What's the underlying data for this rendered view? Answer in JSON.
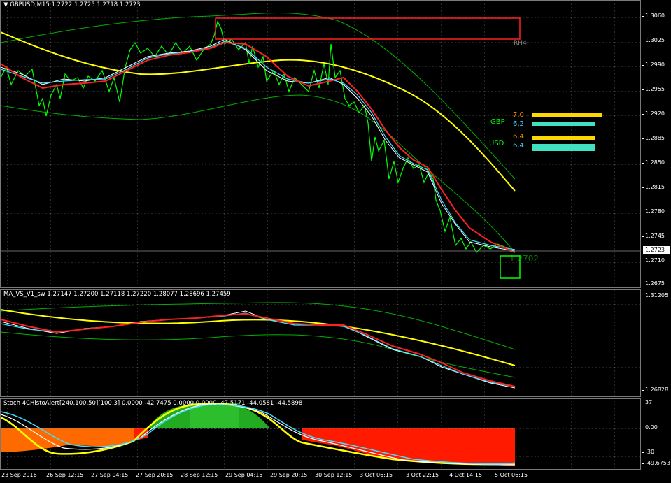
{
  "main_chart": {
    "title": "GBPUSD,M15  1.2722 1.2725 1.2718 1.2723",
    "price_axis": [
      "1.3060",
      "1.3025",
      "1.2990",
      "1.2955",
      "1.2920",
      "1.2885",
      "1.2850",
      "1.2815",
      "1.2780",
      "1.2745",
      "1.2710",
      "1.2675"
    ],
    "current_price": "1.2723",
    "rectangle_label": "RH4",
    "box_label": "1.2702",
    "strength": {
      "gbp": {
        "label": "GBP",
        "value1": "7,0",
        "value2": "6,2"
      },
      "usd": {
        "label": "USD",
        "value1": "6,4",
        "value2": "6,4"
      }
    }
  },
  "indicator1": {
    "title": "MA_VS_V1_sw 1.27147 1.27200 1.27118 1.27220 1.28077 1.28696 1.27459",
    "axis": [
      "1.31205",
      "1.26828"
    ]
  },
  "indicator2": {
    "title": "Stoch 4CHistoAlert[240,100,50][100,3] 0.0000 -42.7475 0.0000 0.0000 -47.5171 -44.0581 -44.5898",
    "axis": [
      "37",
      "0.00",
      "-30",
      "-49.6753"
    ]
  },
  "time_axis": [
    "23 Sep 2016",
    "26 Sep 12:15",
    "27 Sep 04:15",
    "27 Sep 20:15",
    "28 Sep 12:15",
    "29 Sep 04:15",
    "29 Sep 20:15",
    "30 Sep 12:15",
    "3 Oct 06:15",
    "3 Oct 22:15",
    "4 Oct 14:15",
    "5 Oct 06:15"
  ],
  "colors": {
    "price": "#00ff00",
    "ma_red": "#ff2020",
    "ma_yellow": "#ffff00",
    "ma_cyan": "#40e0ff",
    "band_green": "#00b000",
    "histo_red": "#ff1a00",
    "histo_orange": "#ff6a00",
    "histo_green": "#22aa22"
  }
}
